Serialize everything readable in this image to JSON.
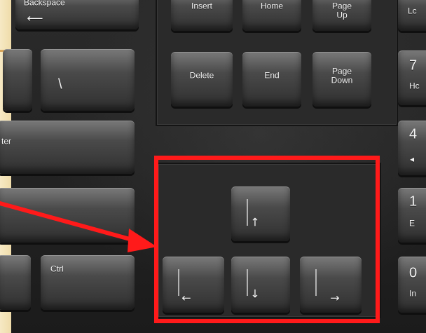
{
  "keys": {
    "backspace": "Backspace",
    "insert": "Insert",
    "home": "Home",
    "page_up": "Page\nUp",
    "delete": "Delete",
    "end": "End",
    "page_down": "Page\nDown",
    "enter_fragment": "ter",
    "ctrl": "Ctrl",
    "numpad_7": "7",
    "numpad_4": "4",
    "numpad_1": "1",
    "numpad_0": "0",
    "numpad_home_fragment": "Hc",
    "numpad_end_fragment": "E",
    "numpad_ins_fragment": "In",
    "numlock_fragment": "Lc",
    "backslash": "\\",
    "arrow_up": "↑",
    "arrow_left": "←",
    "arrow_down": "↓",
    "arrow_right": "→"
  },
  "colors": {
    "highlight": "#ff1a1a",
    "background": "#f2e3b8"
  }
}
